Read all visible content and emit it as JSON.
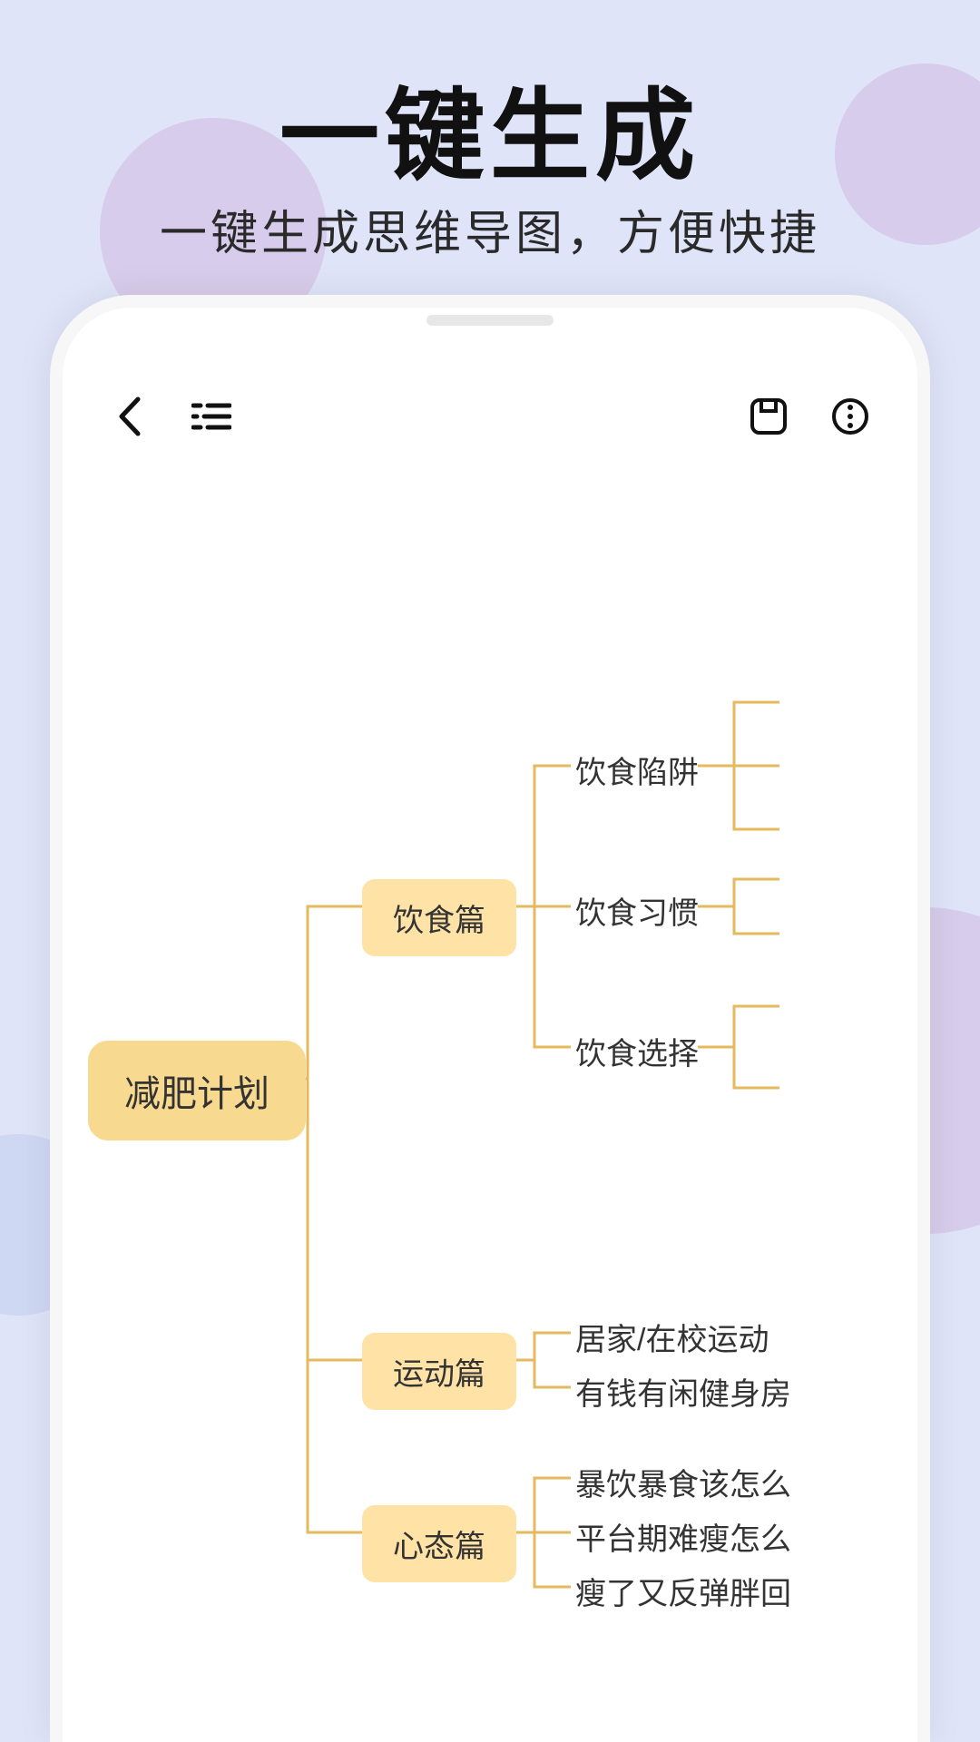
{
  "promo": {
    "title": "一键生成",
    "subtitle": "一键生成思维导图，方便快捷"
  },
  "toolbar": {
    "back_icon": "back",
    "outline_icon": "outline",
    "save_icon": "save",
    "more_icon": "more"
  },
  "mindmap": {
    "root": "减肥计划",
    "categories": [
      {
        "label": "饮食篇",
        "children": [
          "饮食陷阱",
          "饮食习惯",
          "饮食选择"
        ]
      },
      {
        "label": "运动篇",
        "children": [
          "居家/在校运动",
          "有钱有闲健身房"
        ]
      },
      {
        "label": "心态篇",
        "children": [
          "暴饮暴食该怎么",
          "平台期难瘦怎么",
          "瘦了又反弹胖回"
        ]
      }
    ]
  }
}
